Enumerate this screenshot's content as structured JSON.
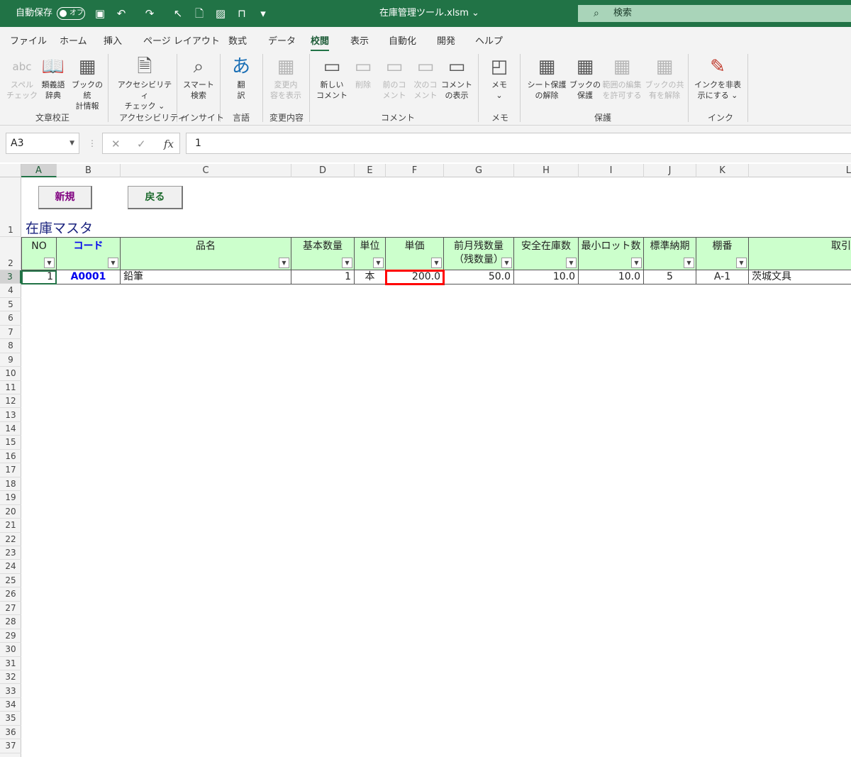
{
  "titlebar": {
    "autosave_label": "自動保存",
    "autosave_state": "オフ",
    "file_title": "在庫管理ツール.xlsm",
    "search_placeholder": "検索"
  },
  "menu": {
    "tabs": [
      "ファイル",
      "ホーム",
      "挿入",
      "ページ レイアウト",
      "数式",
      "データ",
      "校閲",
      "表示",
      "自動化",
      "開発",
      "ヘルプ"
    ],
    "active_tab": "校閲"
  },
  "ribbon": {
    "buttons": [
      {
        "label": "スペル\nチェック",
        "icon": "abc",
        "disabled": true
      },
      {
        "label": "類義語\n辞典",
        "icon": "📖",
        "disabled": false
      },
      {
        "label": "ブックの統\n計情報",
        "icon": "▦",
        "disabled": false
      },
      {
        "label": "アクセシビリティ\nチェック ⌄",
        "icon": "🗎",
        "disabled": false
      },
      {
        "label": "スマート\n検索",
        "icon": "⌕",
        "disabled": false
      },
      {
        "label": "翻\n訳",
        "icon": "あ",
        "disabled": false
      },
      {
        "label": "変更内\n容を表示",
        "icon": "▦",
        "disabled": true
      },
      {
        "label": "新しい\nコメント",
        "icon": "▭",
        "disabled": false
      },
      {
        "label": "削除",
        "icon": "▭",
        "disabled": true
      },
      {
        "label": "前のコ\nメント",
        "icon": "▭",
        "disabled": true
      },
      {
        "label": "次のコ\nメント",
        "icon": "▭",
        "disabled": true
      },
      {
        "label": "コメント\nの表示",
        "icon": "▭",
        "disabled": false
      },
      {
        "label": "メモ\n⌄",
        "icon": "◰",
        "disabled": false
      },
      {
        "label": "シート保護\nの解除",
        "icon": "▦",
        "disabled": false
      },
      {
        "label": "ブックの\n保護",
        "icon": "▦",
        "disabled": false
      },
      {
        "label": "範囲の編集\nを許可する",
        "icon": "▦",
        "disabled": true
      },
      {
        "label": "ブックの共\n有を解除",
        "icon": "▦",
        "disabled": true
      },
      {
        "label": "インクを非表\n示にする ⌄",
        "icon": "✎",
        "disabled": false
      }
    ],
    "groups": [
      "文章校正",
      "アクセシビリティ",
      "インサイト",
      "言語",
      "変更内容",
      "コメント",
      "メモ",
      "保護",
      "インク"
    ]
  },
  "formula_bar": {
    "name_box": "A3",
    "cancel": "✕",
    "enter": "✓",
    "fx": "fx",
    "value": "1"
  },
  "columns": [
    "A",
    "B",
    "C",
    "D",
    "E",
    "F",
    "G",
    "H",
    "I",
    "J",
    "K",
    "L"
  ],
  "rows": [
    "1",
    "2",
    "3",
    "4",
    "5",
    "6",
    "7",
    "8",
    "9",
    "10",
    "11",
    "12",
    "13",
    "14",
    "15",
    "16",
    "17",
    "18",
    "19",
    "20",
    "21",
    "22",
    "23",
    "24",
    "25",
    "26",
    "27",
    "28",
    "29",
    "30",
    "31",
    "32",
    "33",
    "34",
    "35",
    "36",
    "37"
  ],
  "sheet": {
    "new_button": "新規",
    "back_button": "戻る",
    "title": "在庫マスタ",
    "headers": [
      "NO",
      "コード",
      "品名",
      "基本数量",
      "単位",
      "単価",
      "前月残数量\n（残数量）",
      "安全在庫数",
      "最小ロット数",
      "標準納期",
      "棚番",
      "取引"
    ],
    "row": [
      "1",
      "A0001",
      "鉛筆",
      "1",
      "本",
      "200.0",
      "50.0",
      "10.0",
      "10.0",
      "5",
      "A-1",
      "茨城文具"
    ],
    "filter_glyph": "▼"
  },
  "colors": {
    "excel_green": "#217346",
    "header_fill": "#ccffcc",
    "highlight": "#ff0000",
    "title_blue": "#1a237e",
    "code_blue": "#0000ee"
  }
}
